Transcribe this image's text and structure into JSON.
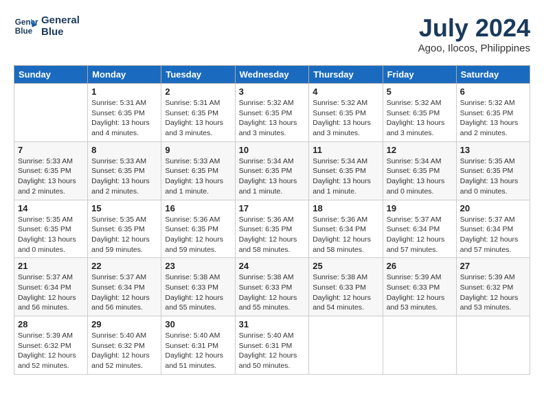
{
  "logo": {
    "line1": "General",
    "line2": "Blue"
  },
  "title": "July 2024",
  "location": "Agoo, Ilocos, Philippines",
  "days_of_week": [
    "Sunday",
    "Monday",
    "Tuesday",
    "Wednesday",
    "Thursday",
    "Friday",
    "Saturday"
  ],
  "weeks": [
    [
      {
        "num": "",
        "data": ""
      },
      {
        "num": "1",
        "data": "Sunrise: 5:31 AM\nSunset: 6:35 PM\nDaylight: 13 hours\nand 4 minutes."
      },
      {
        "num": "2",
        "data": "Sunrise: 5:31 AM\nSunset: 6:35 PM\nDaylight: 13 hours\nand 3 minutes."
      },
      {
        "num": "3",
        "data": "Sunrise: 5:32 AM\nSunset: 6:35 PM\nDaylight: 13 hours\nand 3 minutes."
      },
      {
        "num": "4",
        "data": "Sunrise: 5:32 AM\nSunset: 6:35 PM\nDaylight: 13 hours\nand 3 minutes."
      },
      {
        "num": "5",
        "data": "Sunrise: 5:32 AM\nSunset: 6:35 PM\nDaylight: 13 hours\nand 3 minutes."
      },
      {
        "num": "6",
        "data": "Sunrise: 5:32 AM\nSunset: 6:35 PM\nDaylight: 13 hours\nand 2 minutes."
      }
    ],
    [
      {
        "num": "7",
        "data": "Sunrise: 5:33 AM\nSunset: 6:35 PM\nDaylight: 13 hours\nand 2 minutes."
      },
      {
        "num": "8",
        "data": "Sunrise: 5:33 AM\nSunset: 6:35 PM\nDaylight: 13 hours\nand 2 minutes."
      },
      {
        "num": "9",
        "data": "Sunrise: 5:33 AM\nSunset: 6:35 PM\nDaylight: 13 hours\nand 1 minute."
      },
      {
        "num": "10",
        "data": "Sunrise: 5:34 AM\nSunset: 6:35 PM\nDaylight: 13 hours\nand 1 minute."
      },
      {
        "num": "11",
        "data": "Sunrise: 5:34 AM\nSunset: 6:35 PM\nDaylight: 13 hours\nand 1 minute."
      },
      {
        "num": "12",
        "data": "Sunrise: 5:34 AM\nSunset: 6:35 PM\nDaylight: 13 hours\nand 0 minutes."
      },
      {
        "num": "13",
        "data": "Sunrise: 5:35 AM\nSunset: 6:35 PM\nDaylight: 13 hours\nand 0 minutes."
      }
    ],
    [
      {
        "num": "14",
        "data": "Sunrise: 5:35 AM\nSunset: 6:35 PM\nDaylight: 13 hours\nand 0 minutes."
      },
      {
        "num": "15",
        "data": "Sunrise: 5:35 AM\nSunset: 6:35 PM\nDaylight: 12 hours\nand 59 minutes."
      },
      {
        "num": "16",
        "data": "Sunrise: 5:36 AM\nSunset: 6:35 PM\nDaylight: 12 hours\nand 59 minutes."
      },
      {
        "num": "17",
        "data": "Sunrise: 5:36 AM\nSunset: 6:35 PM\nDaylight: 12 hours\nand 58 minutes."
      },
      {
        "num": "18",
        "data": "Sunrise: 5:36 AM\nSunset: 6:34 PM\nDaylight: 12 hours\nand 58 minutes."
      },
      {
        "num": "19",
        "data": "Sunrise: 5:37 AM\nSunset: 6:34 PM\nDaylight: 12 hours\nand 57 minutes."
      },
      {
        "num": "20",
        "data": "Sunrise: 5:37 AM\nSunset: 6:34 PM\nDaylight: 12 hours\nand 57 minutes."
      }
    ],
    [
      {
        "num": "21",
        "data": "Sunrise: 5:37 AM\nSunset: 6:34 PM\nDaylight: 12 hours\nand 56 minutes."
      },
      {
        "num": "22",
        "data": "Sunrise: 5:37 AM\nSunset: 6:34 PM\nDaylight: 12 hours\nand 56 minutes."
      },
      {
        "num": "23",
        "data": "Sunrise: 5:38 AM\nSunset: 6:33 PM\nDaylight: 12 hours\nand 55 minutes."
      },
      {
        "num": "24",
        "data": "Sunrise: 5:38 AM\nSunset: 6:33 PM\nDaylight: 12 hours\nand 55 minutes."
      },
      {
        "num": "25",
        "data": "Sunrise: 5:38 AM\nSunset: 6:33 PM\nDaylight: 12 hours\nand 54 minutes."
      },
      {
        "num": "26",
        "data": "Sunrise: 5:39 AM\nSunset: 6:33 PM\nDaylight: 12 hours\nand 53 minutes."
      },
      {
        "num": "27",
        "data": "Sunrise: 5:39 AM\nSunset: 6:32 PM\nDaylight: 12 hours\nand 53 minutes."
      }
    ],
    [
      {
        "num": "28",
        "data": "Sunrise: 5:39 AM\nSunset: 6:32 PM\nDaylight: 12 hours\nand 52 minutes."
      },
      {
        "num": "29",
        "data": "Sunrise: 5:40 AM\nSunset: 6:32 PM\nDaylight: 12 hours\nand 52 minutes."
      },
      {
        "num": "30",
        "data": "Sunrise: 5:40 AM\nSunset: 6:31 PM\nDaylight: 12 hours\nand 51 minutes."
      },
      {
        "num": "31",
        "data": "Sunrise: 5:40 AM\nSunset: 6:31 PM\nDaylight: 12 hours\nand 50 minutes."
      },
      {
        "num": "",
        "data": ""
      },
      {
        "num": "",
        "data": ""
      },
      {
        "num": "",
        "data": ""
      }
    ]
  ]
}
